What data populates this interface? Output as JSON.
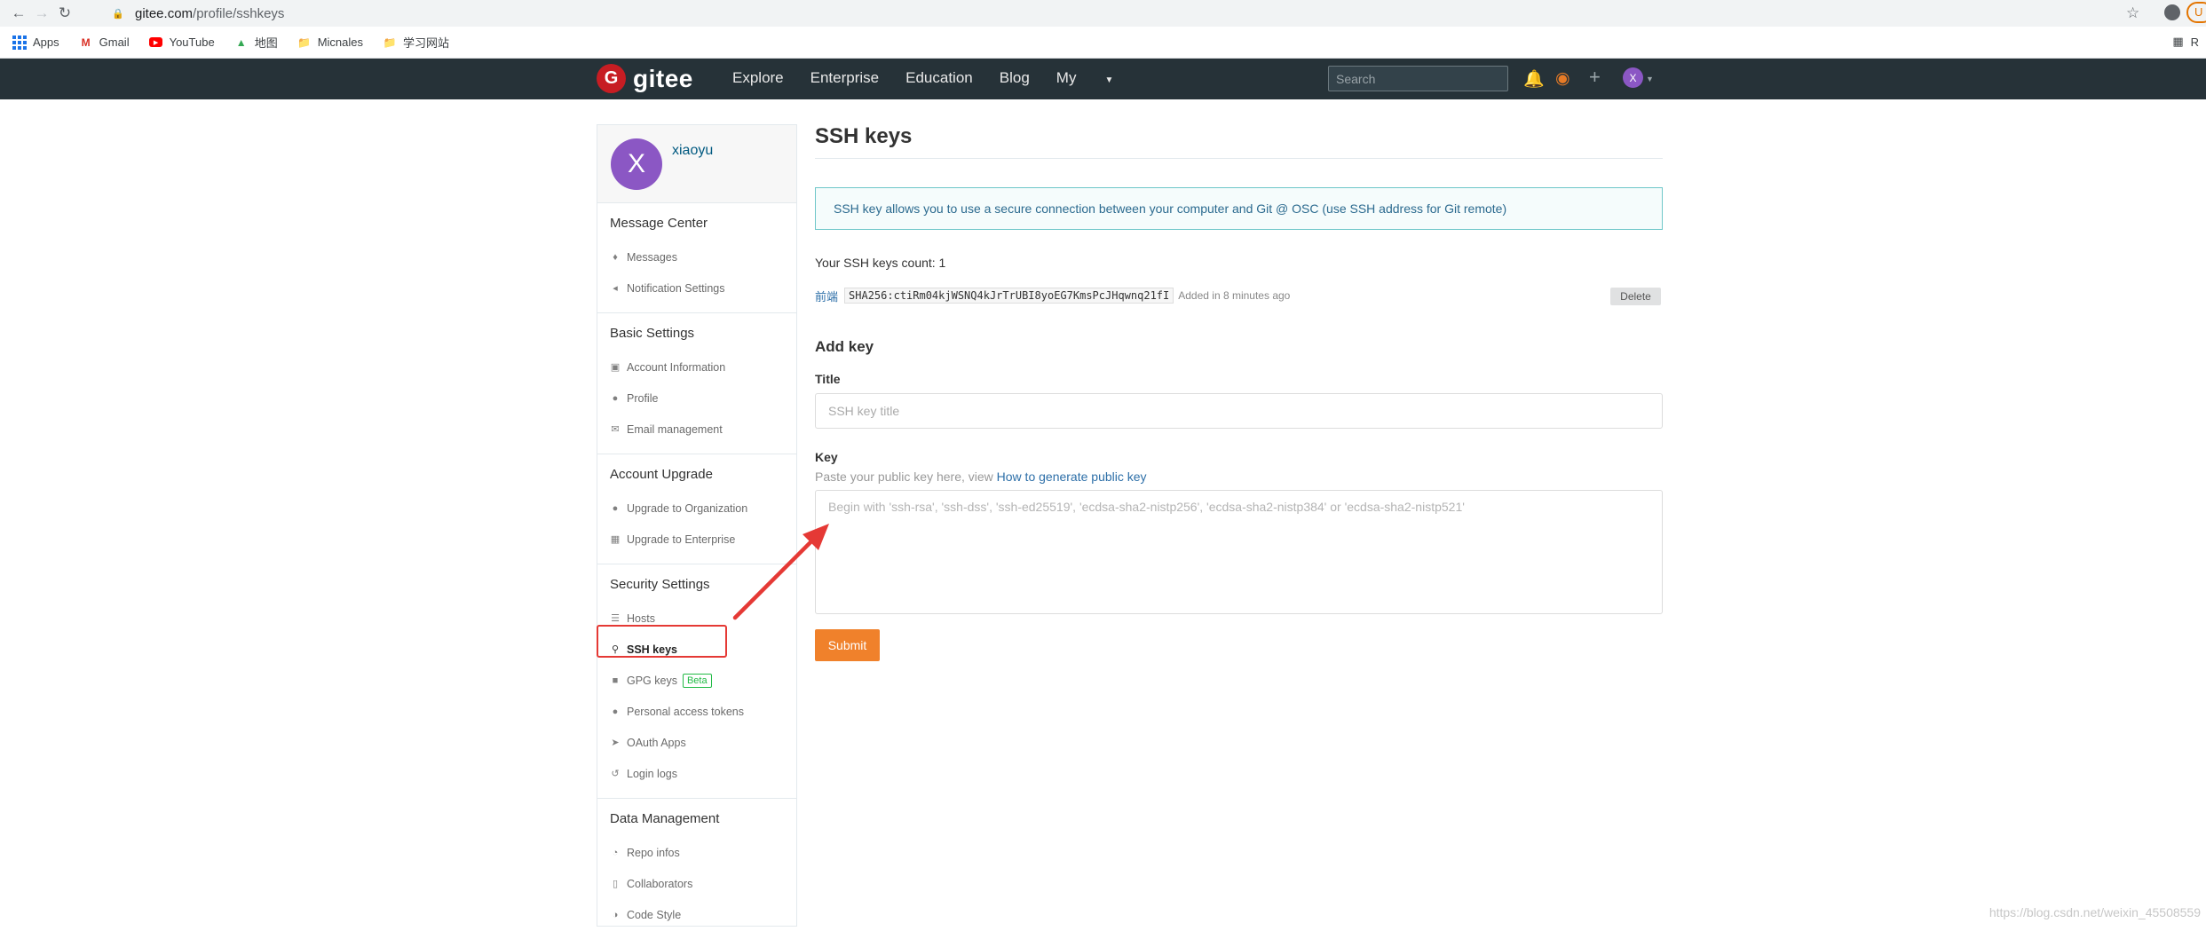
{
  "browser": {
    "url_host": "gitee.com",
    "url_path": "/profile/sshkeys",
    "profile_initial": "U",
    "bookmarks": [
      {
        "label": "Apps",
        "icon": "apps-grid-icon"
      },
      {
        "label": "Gmail",
        "icon": "gmail-icon"
      },
      {
        "label": "YouTube",
        "icon": "youtube-icon"
      },
      {
        "label": "地图",
        "icon": "maps-icon"
      },
      {
        "label": "Micnales",
        "icon": "folder-icon"
      },
      {
        "label": "学习网站",
        "icon": "folder-icon"
      }
    ],
    "reading_list": "R"
  },
  "header": {
    "logo": "gitee",
    "nav": [
      "Explore",
      "Enterprise",
      "Education",
      "Blog",
      "My"
    ],
    "search_placeholder": "Search",
    "avatar_initial": "X"
  },
  "sidebar": {
    "avatar_initial": "X",
    "username": "xiaoyu",
    "sections": [
      {
        "title": "Message Center",
        "items": [
          {
            "label": "Messages",
            "icon": "bell-icon"
          },
          {
            "label": "Notification Settings",
            "icon": "speaker-icon"
          }
        ]
      },
      {
        "title": "Basic Settings",
        "items": [
          {
            "label": "Account Information",
            "icon": "id-card-icon"
          },
          {
            "label": "Profile",
            "icon": "user-icon"
          },
          {
            "label": "Email management",
            "icon": "mail-icon"
          }
        ]
      },
      {
        "title": "Account Upgrade",
        "items": [
          {
            "label": "Upgrade to Organization",
            "icon": "users-icon"
          },
          {
            "label": "Upgrade to Enterprise",
            "icon": "building-icon"
          }
        ]
      },
      {
        "title": "Security Settings",
        "items": [
          {
            "label": "Hosts",
            "icon": "list-icon"
          },
          {
            "label": "SSH keys",
            "icon": "key-icon",
            "active": true
          },
          {
            "label": "GPG keys",
            "icon": "lock-icon",
            "badge": "Beta"
          },
          {
            "label": "Personal access tokens",
            "icon": "token-icon"
          },
          {
            "label": "OAuth Apps",
            "icon": "rocket-icon"
          },
          {
            "label": "Login logs",
            "icon": "history-icon"
          }
        ]
      },
      {
        "title": "Data Management",
        "items": [
          {
            "label": "Repo infos",
            "icon": "pie-icon"
          },
          {
            "label": "Collaborators",
            "icon": "file-icon"
          },
          {
            "label": "Code Style",
            "icon": "palette-icon"
          }
        ]
      }
    ]
  },
  "main": {
    "title": "SSH keys",
    "info": "SSH key allows you to use a secure connection between your computer and Git @ OSC (use SSH address for Git remote)",
    "count_text": "Your SSH keys count: 1",
    "keys": [
      {
        "title": "前端",
        "fingerprint": "SHA256:ctiRm04kjWSNQ4kJrTrUBI8yoEG7KmsPcJHqwnq21fI",
        "added": "Added in 8 minutes ago",
        "delete_label": "Delete"
      }
    ],
    "add_title": "Add key",
    "title_label": "Title",
    "title_placeholder": "SSH key title",
    "key_label": "Key",
    "key_help_text": "Paste your public key here, view ",
    "key_help_link": "How to generate public key",
    "key_placeholder": "Begin with 'ssh-rsa', 'ssh-dss', 'ssh-ed25519', 'ecdsa-sha2-nistp256', 'ecdsa-sha2-nistp384' or 'ecdsa-sha2-nistp521'",
    "submit_label": "Submit"
  },
  "watermark": "https://blog.csdn.net/weixin_45508559",
  "colors": {
    "header_bg": "#263238",
    "brand": "#c71d23",
    "submit": "#f0812b",
    "annotation": "#e53935"
  }
}
